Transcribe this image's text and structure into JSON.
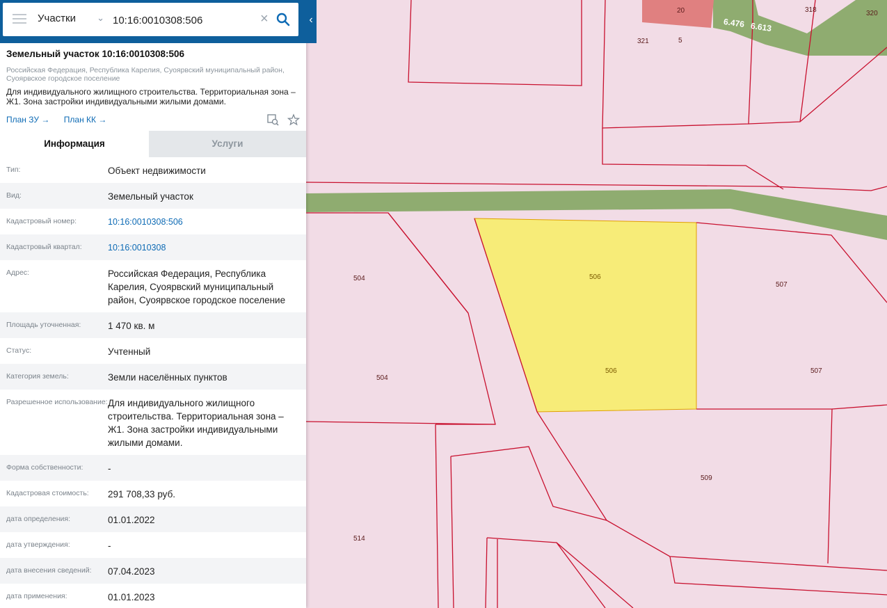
{
  "search": {
    "type_label": "Участки",
    "query": "10:16:0010308:506"
  },
  "header": {
    "title": "Земельный участок 10:16:0010308:506",
    "address": "Российская Федерация, Республика Карелия, Суоярвский муниципальный район, Суоярвское городское поселение",
    "purpose": "Для индивидуального жилищного строительства. Территориальная зона – Ж1. Зона застройки индивидуальными жилыми домами.",
    "link_plan_zu": "План ЗУ →",
    "link_plan_kk": "План КК →"
  },
  "tabs": [
    {
      "label": "Информация",
      "active": true
    },
    {
      "label": "Услуги",
      "active": false
    }
  ],
  "info": [
    {
      "label": "Тип:",
      "value": "Объект недвижимости"
    },
    {
      "label": "Вид:",
      "value": "Земельный участок"
    },
    {
      "label": "Кадастровый номер:",
      "value": "10:16:0010308:506"
    },
    {
      "label": "Кадастровый квартал:",
      "value": "10:16:0010308"
    },
    {
      "label": "Адрес:",
      "value": "Российская Федерация, Республика Карелия, Суоярвский муниципальный район, Суоярвское городское поселение"
    },
    {
      "label": "Площадь уточненная:",
      "value": "1 470 кв. м"
    },
    {
      "label": "Статус:",
      "value": "Учтенный"
    },
    {
      "label": "Категория земель:",
      "value": "Земли населённых пунктов"
    },
    {
      "label": "Разрешенное использование:",
      "value": "Для индивидуального жилищного строительства. Территориальная зона – Ж1. Зона застройки индивидуальными жилыми домами."
    },
    {
      "label": "Форма собственности:",
      "value": "-"
    },
    {
      "label": "Кадастровая стоимость:",
      "value": "291 708,33 руб."
    },
    {
      "label": "дата определения:",
      "value": "01.01.2022"
    },
    {
      "label": "дата утверждения:",
      "value": "-"
    },
    {
      "label": "дата внесения сведений:",
      "value": "07.04.2023"
    },
    {
      "label": "дата применения:",
      "value": "01.01.2023"
    }
  ],
  "map": {
    "labels": {
      "p20": "20",
      "p318": "318",
      "p320": "320",
      "p321": "321",
      "p5": "5",
      "road1": "6.476",
      "road2": "6.613",
      "p504a": "504",
      "p504b": "504",
      "p506a": "506",
      "p506b": "506",
      "p507a": "507",
      "p507b": "507",
      "p509": "509",
      "p514": "514"
    },
    "colors": {
      "background": "#f2dce6",
      "boundary": "#c8102e",
      "road": "#8fac70",
      "selected_fill": "#f7ec78",
      "building": "#e08080"
    }
  },
  "icons": [
    "hamburger-icon",
    "chevron-down-icon",
    "close-icon",
    "search-icon",
    "chevron-left-icon",
    "map-search-icon",
    "star-icon"
  ]
}
